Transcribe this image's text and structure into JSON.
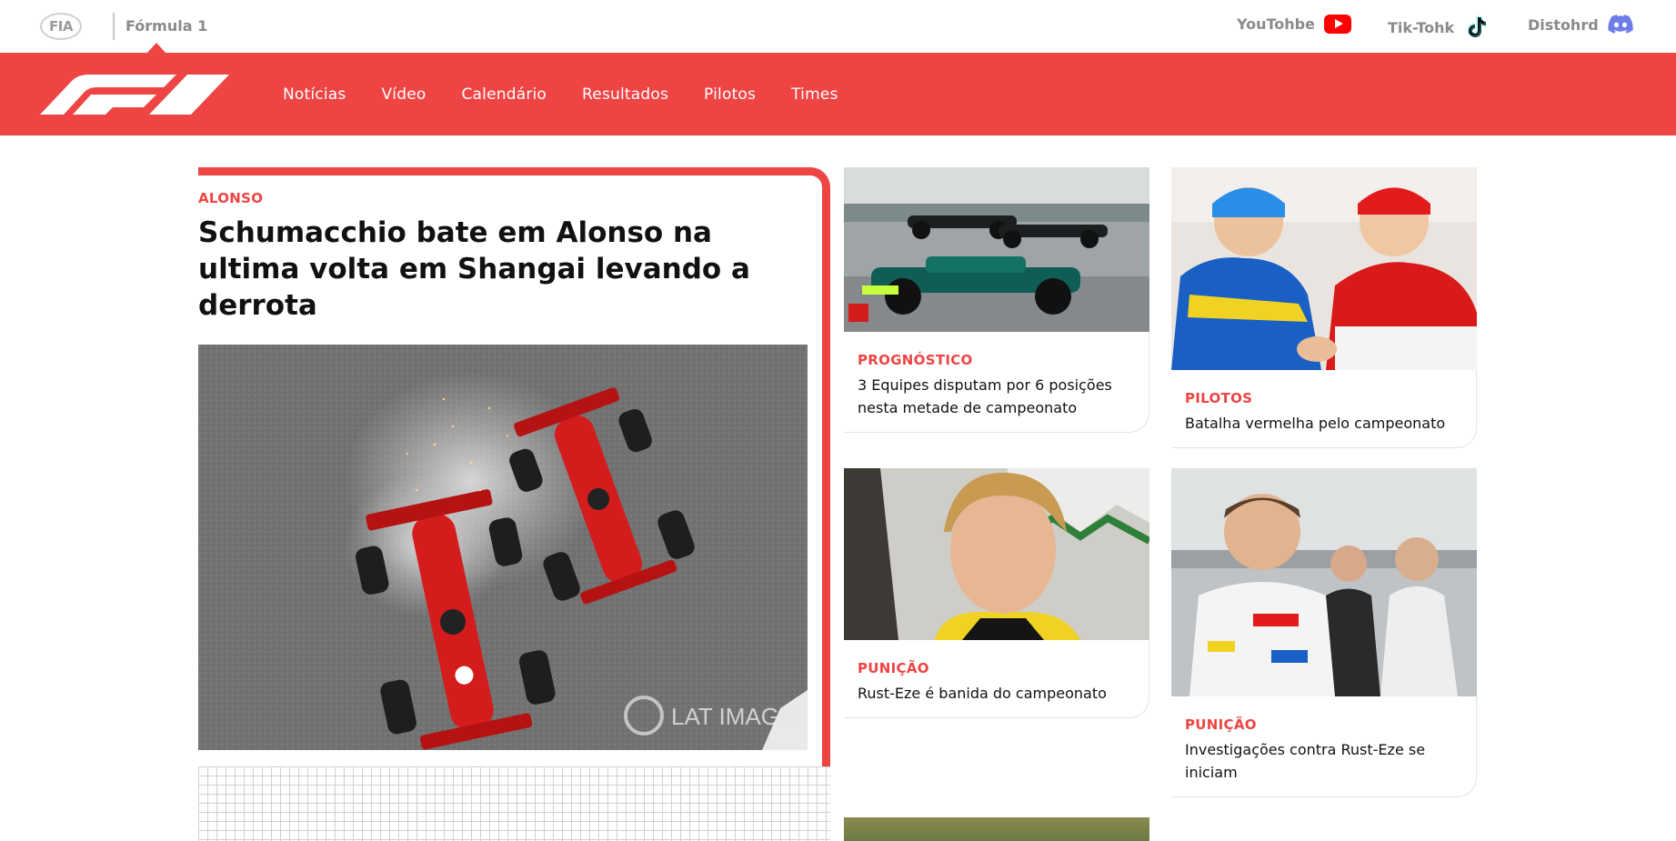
{
  "topbar": {
    "fia_logo": "FIA",
    "brand_label": "Fórmula 1",
    "socials": [
      {
        "label": "YouTohbe",
        "icon": "youtube-icon",
        "color": "#ff0000"
      },
      {
        "label": "Tik-Tohk",
        "icon": "tiktok-icon",
        "color": "#111111"
      },
      {
        "label": "Distohrd",
        "icon": "discord-icon",
        "color": "#6d7ce8"
      }
    ]
  },
  "nav": {
    "logo": "f1-logo",
    "links": [
      "Notícias",
      "Vídeo",
      "Calendário",
      "Resultados",
      "Pilotos",
      "Times"
    ]
  },
  "featured": {
    "tag": "ALONSO",
    "title": "Schumacchio bate em Alonso na ultima volta em Shangai levando a derrota",
    "image_watermark": "LAT IMAGES"
  },
  "cards": [
    {
      "tag": "PROGNÓSTICO",
      "title": "3 Equipes disputam por 6 posições nesta metade de campeonato"
    },
    {
      "tag": "PILOTOS",
      "title": "Batalha vermelha pelo campeonato"
    },
    {
      "tag": "PUNIÇÃO",
      "title": "Rust-Eze é banida do campeonato"
    },
    {
      "tag": "PUNIÇÃO",
      "title": "Investigações contra Rust-Eze se iniciam"
    }
  ],
  "colors": {
    "accent": "#ef4444",
    "text": "#111111",
    "muted": "#8a8a8a"
  }
}
